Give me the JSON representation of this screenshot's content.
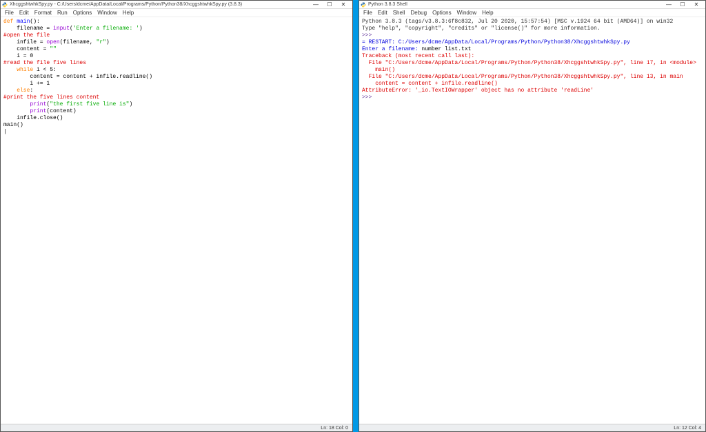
{
  "left": {
    "title": "XhcggshtwhkSpy.py - C:/Users/dcme/AppData/Local/Programs/Python/Python38/XhcggshtwhkSpy.py (3.8.3)",
    "menu": [
      "File",
      "Edit",
      "Format",
      "Run",
      "Options",
      "Window",
      "Help"
    ],
    "lines": [
      {
        "segs": [
          {
            "c": "kw",
            "t": "def "
          },
          {
            "c": "def",
            "t": "main"
          },
          {
            "t": "():"
          }
        ]
      },
      {
        "segs": [
          {
            "t": "    filename = "
          },
          {
            "c": "bui",
            "t": "input"
          },
          {
            "t": "("
          },
          {
            "c": "str",
            "t": "'Enter a filename: '"
          },
          {
            "t": ")"
          }
        ]
      },
      {
        "segs": [
          {
            "c": "com",
            "t": "#open the file"
          }
        ]
      },
      {
        "segs": [
          {
            "t": "    infile = "
          },
          {
            "c": "bui",
            "t": "open"
          },
          {
            "t": "(filename, "
          },
          {
            "c": "str",
            "t": "\"r\""
          },
          {
            "t": ")"
          }
        ]
      },
      {
        "segs": [
          {
            "t": "    content = "
          },
          {
            "c": "str",
            "t": "\"\""
          }
        ]
      },
      {
        "segs": [
          {
            "t": "    i = 0"
          }
        ]
      },
      {
        "segs": [
          {
            "c": "com",
            "t": "#read the file five lines"
          }
        ]
      },
      {
        "segs": [
          {
            "t": "    "
          },
          {
            "c": "kw",
            "t": "while"
          },
          {
            "t": " i < 5:"
          }
        ]
      },
      {
        "segs": [
          {
            "t": "        content = content + infile.readline()"
          }
        ]
      },
      {
        "segs": [
          {
            "t": "        i += 1"
          }
        ]
      },
      {
        "segs": [
          {
            "t": "    "
          },
          {
            "c": "kw",
            "t": "else"
          },
          {
            "t": ":"
          }
        ]
      },
      {
        "segs": [
          {
            "c": "com",
            "t": "#print the five lines content"
          }
        ]
      },
      {
        "segs": [
          {
            "t": "        "
          },
          {
            "c": "bui",
            "t": "print"
          },
          {
            "t": "("
          },
          {
            "c": "str",
            "t": "\"the first five line is\""
          },
          {
            "t": ")"
          }
        ]
      },
      {
        "segs": [
          {
            "t": "        "
          },
          {
            "c": "bui",
            "t": "print"
          },
          {
            "t": "(content)"
          }
        ]
      },
      {
        "segs": [
          {
            "t": "    infile.close()"
          }
        ]
      },
      {
        "segs": [
          {
            "t": ""
          }
        ]
      },
      {
        "segs": [
          {
            "t": "main()"
          }
        ]
      },
      {
        "segs": [
          {
            "t": "|"
          }
        ]
      }
    ],
    "status": "Ln: 18  Col: 0"
  },
  "right": {
    "title": "Python 3.8.3 Shell",
    "menu": [
      "File",
      "Edit",
      "Shell",
      "Debug",
      "Options",
      "Window",
      "Help"
    ],
    "lines": [
      {
        "segs": [
          {
            "c": "shell-intro",
            "t": "Python 3.8.3 (tags/v3.8.3:6f8c832, Jul 20 2020, 15:57:54) [MSC v.1924 64 bit (AMD64)] on win32"
          }
        ]
      },
      {
        "segs": [
          {
            "c": "shell-intro",
            "t": "Type \"help\", \"copyright\", \"credits\" or \"license()\" for more information."
          }
        ]
      },
      {
        "segs": [
          {
            "c": "prompt",
            "t": ">>> "
          }
        ]
      },
      {
        "segs": [
          {
            "c": "shell-blue",
            "t": "= RESTART: C:/Users/dcme/AppData/Local/Programs/Python/Python38/XhcggshtwhkSpy.py"
          }
        ]
      },
      {
        "segs": [
          {
            "c": "shell-blue",
            "t": "Enter a filename: "
          },
          {
            "t": "number list.txt"
          }
        ]
      },
      {
        "segs": [
          {
            "c": "err",
            "t": "Traceback (most recent call last):"
          }
        ]
      },
      {
        "segs": [
          {
            "c": "err",
            "t": "  File \"C:/Users/dcme/AppData/Local/Programs/Python/Python38/XhcggshtwhkSpy.py\", line 17, in <module>"
          }
        ]
      },
      {
        "segs": [
          {
            "c": "err",
            "t": "    main()"
          }
        ]
      },
      {
        "segs": [
          {
            "c": "err",
            "t": "  File \"C:/Users/dcme/AppData/Local/Programs/Python/Python38/XhcggshtwhkSpy.py\", line 13, in main"
          }
        ]
      },
      {
        "segs": [
          {
            "c": "err",
            "t": "    content = content + infile.readline()"
          }
        ]
      },
      {
        "segs": [
          {
            "c": "err",
            "t": "AttributeError: '_io.TextIOWrapper' object has no attribute 'readLine'"
          }
        ]
      },
      {
        "segs": [
          {
            "c": "prompt",
            "t": ">>> "
          }
        ]
      }
    ],
    "status": "Ln: 12  Col: 4"
  },
  "win_buttons": {
    "min": "—",
    "max": "☐",
    "close": "✕"
  }
}
